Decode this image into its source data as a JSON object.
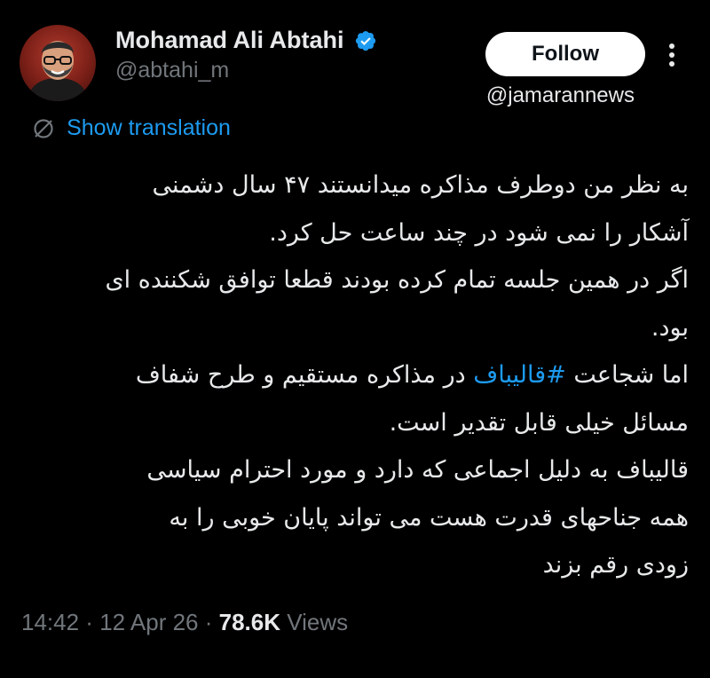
{
  "author": {
    "display_name": "Mohamad Ali Abtahi",
    "handle": "@abtahi_m",
    "verified": true
  },
  "follow_button": {
    "label": "Follow"
  },
  "watermark": "@jamarannews",
  "translate": {
    "label": "Show translation"
  },
  "tweet": {
    "line1": "به نظر من دوطرف مذاکره میدانستند ۴۷ سال دشمنی",
    "line2": "آشکار را نمی شود در چند ساعت حل کرد.",
    "line3": "اگر در همین جلسه تمام کرده بودند قطعا توافق شکننده ای",
    "line4": "بود.",
    "line5_before": "اما شجاعت ",
    "hashtag": "#قالیباف",
    "line5_after": " در مذاکره مستقیم و طرح شفاف",
    "line6": "مسائل خیلی قابل تقدیر است.",
    "line7": "قالیباف به دلیل اجماعی که دارد و مورد احترام سیاسی",
    "line8": "همه جناحهای قدرت هست می تواند پایان خوبی را به",
    "line9": "زودی رقم بزند"
  },
  "meta": {
    "time": "14:42",
    "sep1": " · ",
    "date": "12 Apr 26",
    "sep2": " · ",
    "views": "78.6K",
    "views_label": " Views"
  },
  "colors": {
    "background": "#000000",
    "text": "#e7e9ea",
    "muted": "#71767b",
    "link": "#1d9bf0",
    "follow_bg": "#ffffff"
  },
  "icons": {
    "verified": "verified-badge-icon",
    "more": "more-vertical-icon",
    "translate": "translate-globe-icon"
  }
}
